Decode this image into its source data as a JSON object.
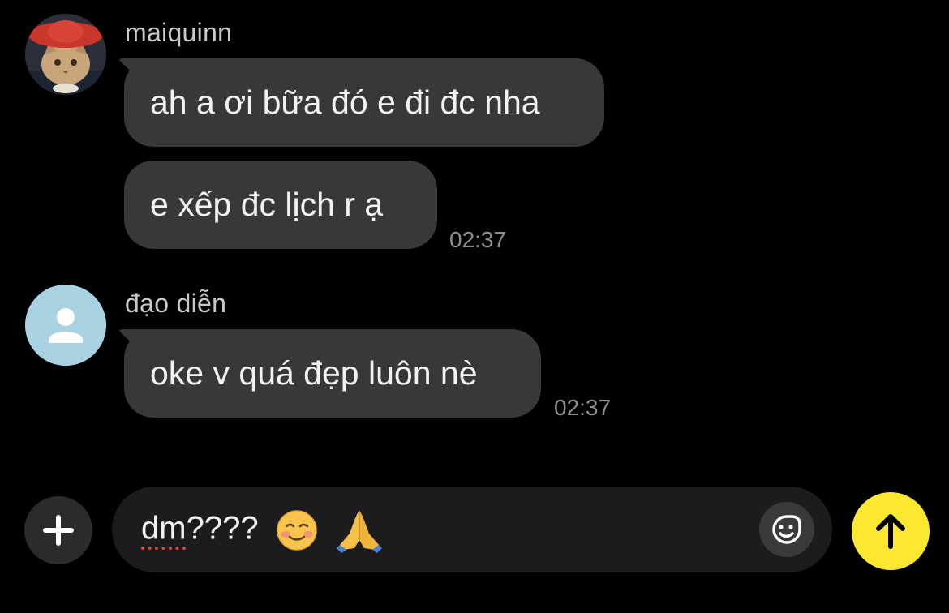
{
  "colors": {
    "background": "#000000",
    "bubble": "#38383b",
    "input_background": "#1c1c1e",
    "send_button": "#fce731",
    "timestamp": "#8e8e93",
    "sender_name": "#c9c9cc"
  },
  "messages": [
    {
      "sender": "maiquinn",
      "avatar_icon": "cat-avatar-photo",
      "bubbles": [
        "ah a ơi bữa đó e đi đc nha",
        "e xếp đc lịch r ạ"
      ],
      "time": "02:37"
    },
    {
      "sender": "đạo diễn",
      "avatar_icon": "default-user-avatar-icon",
      "bubbles": [
        "oke v quá đẹp luôn nè"
      ],
      "time": "02:37"
    }
  ],
  "composer": {
    "text_misspelled": "dm",
    "text_rest": "????",
    "emojis": [
      "smiling-face-emoji",
      "folded-hands-emoji"
    ],
    "attach_icon": "plus-icon",
    "sticker_icon": "sticker-smile-icon",
    "send_icon": "arrow-up-icon"
  }
}
